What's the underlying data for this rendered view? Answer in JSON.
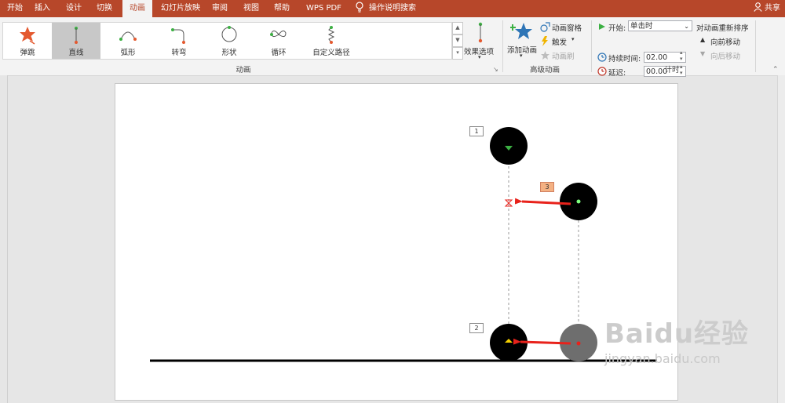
{
  "tabs": [
    {
      "label": "开始",
      "active": false
    },
    {
      "label": "插入",
      "active": false
    },
    {
      "label": "设计",
      "active": false
    },
    {
      "label": "切换",
      "active": false
    },
    {
      "label": "动画",
      "active": true
    },
    {
      "label": "幻灯片放映",
      "active": false
    },
    {
      "label": "审阅",
      "active": false
    },
    {
      "label": "视图",
      "active": false
    },
    {
      "label": "帮助",
      "active": false
    },
    {
      "label": "WPS PDF",
      "active": false
    }
  ],
  "tell_me": "操作说明搜索",
  "share": "共享",
  "gallery": {
    "items": [
      {
        "label": "弹跳",
        "icon": "bounce-icon"
      },
      {
        "label": "直线",
        "icon": "lines-icon",
        "selected": true
      },
      {
        "label": "弧形",
        "icon": "arc-icon"
      },
      {
        "label": "转弯",
        "icon": "turn-icon"
      },
      {
        "label": "形状",
        "icon": "shape-icon"
      },
      {
        "label": "循环",
        "icon": "loop-icon"
      },
      {
        "label": "自定义路径",
        "icon": "custom-path-icon"
      }
    ],
    "group_label": "动画"
  },
  "effect_options": "效果选项",
  "advanced": {
    "add_animation": "添加动画",
    "animation_pane": "动画窗格",
    "trigger": "触发",
    "animation_painter": "动画刷",
    "group_label": "高级动画"
  },
  "timing": {
    "start_label": "开始:",
    "start_value": "单击时",
    "duration_label": "持续时间:",
    "duration_value": "02.00",
    "delay_label": "延迟:",
    "delay_value": "00.00",
    "reorder_label": "对动画重新排序",
    "move_earlier": "向前移动",
    "move_later": "向后移动",
    "group_label": "计时"
  },
  "slide": {
    "tags": [
      "1",
      "2",
      "3"
    ]
  },
  "watermark": {
    "brand": "Baidu经验",
    "url": "jingyan.baidu.com"
  },
  "colors": {
    "accent": "#b7472a",
    "arrow": "#e8221b",
    "path_start": "#3cb043"
  }
}
